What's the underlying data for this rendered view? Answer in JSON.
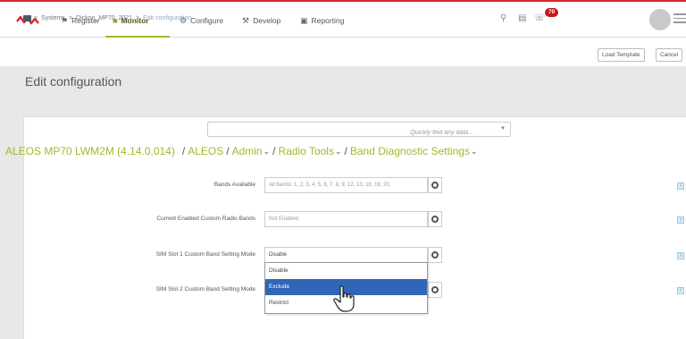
{
  "nav": {
    "items": [
      {
        "label": "Register",
        "icon": "flag-icon",
        "glyph": "⚑"
      },
      {
        "label": "Monitor",
        "icon": "monitor-icon",
        "glyph": "■"
      },
      {
        "label": "Configure",
        "icon": "gear-icon",
        "glyph": "⚙"
      },
      {
        "label": "Develop",
        "icon": "tools-icon",
        "glyph": "⚒"
      },
      {
        "label": "Reporting",
        "icon": "report-icon",
        "glyph": "▣"
      }
    ],
    "active": "Monitor",
    "alert_count": "70",
    "accent_color": "#9cbb2a",
    "brand_color": "#d9262b"
  },
  "breadcrumb": {
    "items": [
      "Systems",
      "Dickon_MP70_2021",
      "Edit configuration"
    ],
    "separator": ">"
  },
  "toolbar": {
    "load_template": "Load Template",
    "cancel": "Cancel"
  },
  "page": {
    "title": "Edit configuration"
  },
  "search": {
    "placeholder": "Quickly find any data..."
  },
  "path": {
    "root": "ALEOS MP70 LWM2M (4.14.0.014)",
    "segments": [
      "ALEOS",
      "Admin",
      "Radio Tools",
      "Band Diagnostic Settings"
    ],
    "separator": "/"
  },
  "rows": [
    {
      "label": "Bands Available",
      "value": "All bands: 1, 2, 3, 4, 5, 6, 7, 8, 9, 12, 13, 18, 19, 20,"
    },
    {
      "label": "Current Enabled Custom Radio Bands",
      "value": "Not Enabled"
    },
    {
      "label": "SIM Slot 1 Custom Band Setting Mode",
      "value": "Disable"
    },
    {
      "label": "SIM Slot 2 Custom Band Setting Mode",
      "value": ""
    }
  ],
  "dropdown": {
    "options": [
      "Disable",
      "Exclude",
      "Restrict"
    ],
    "highlighted": "Exclude"
  },
  "info_label": "i"
}
